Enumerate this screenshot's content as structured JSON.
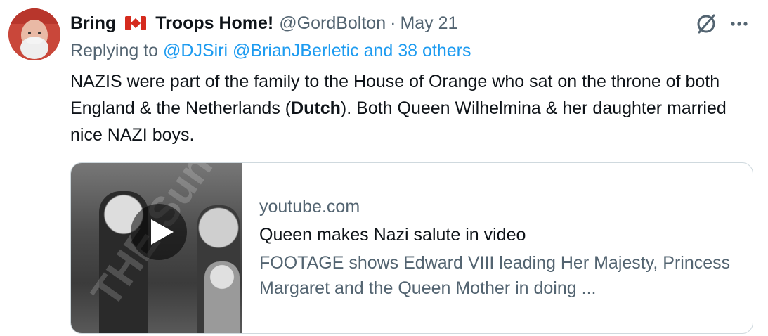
{
  "tweet": {
    "display_name_part1": "Bring",
    "flag_icon": "canada-flag-icon",
    "display_name_part2": "Troops Home!",
    "handle": "@GordBolton",
    "separator": "·",
    "date": "May 21",
    "replying_prefix": "Replying to",
    "replying_to": [
      "@DJSiri",
      "@BrianJBerletic",
      "and 38 others"
    ],
    "body_part1": "NAZIS were part of the family to the House of Orange who sat on the throne of both England & the Netherlands (",
    "body_bold": "Dutch",
    "body_part2": "). Both Queen Wilhelmina & her daughter married nice NAZI boys."
  },
  "card": {
    "domain": "youtube.com",
    "title": "Queen makes Nazi salute in video",
    "description": "FOOTAGE shows Edward VIII leading Her Majesty, Princess Margaret and the Queen Mother in doing ...",
    "thumbnail_watermark": "THE Sun",
    "thumbnail_icon": "play-icon"
  },
  "icons": {
    "grok": "grok-icon",
    "more": "more-icon"
  },
  "colors": {
    "link": "#1d9bf0",
    "secondary_text": "#536471",
    "primary_text": "#0f1419",
    "border": "#cfd9de"
  }
}
